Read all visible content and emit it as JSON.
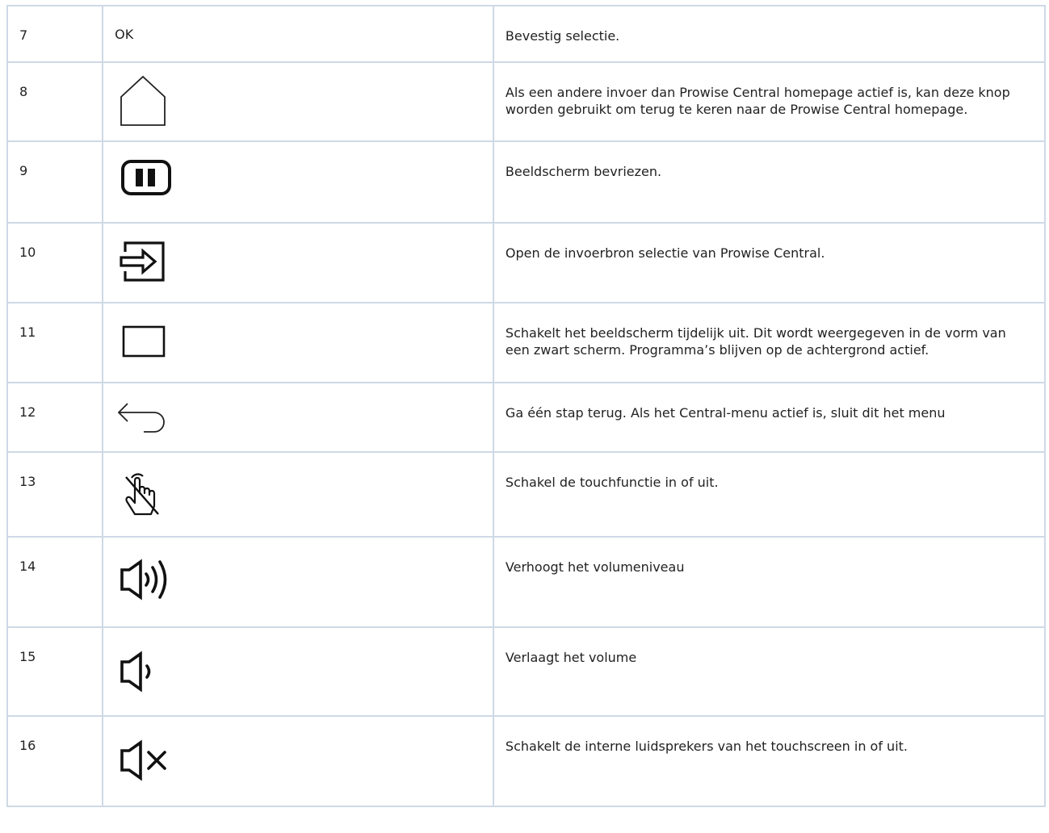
{
  "rows": [
    {
      "number": "7",
      "icon": "ok-text",
      "icon_text": "OK",
      "description": "Bevestig selectie."
    },
    {
      "number": "8",
      "icon": "home-icon",
      "description": "Als een andere invoer dan Prowise Central homepage actief is, kan deze knop worden gebruikt om terug te keren naar de Prowise Central homepage."
    },
    {
      "number": "9",
      "icon": "pause-icon",
      "description": "Beeldscherm bevriezen."
    },
    {
      "number": "10",
      "icon": "input-source-icon",
      "description": "Open de invoerbron selectie van Prowise Central."
    },
    {
      "number": "11",
      "icon": "blank-screen-icon",
      "description": "Schakelt het beeldscherm tijdelijk uit. Dit wordt weergegeven in de vorm van een zwart scherm. Programma’s blijven op de achtergrond actief."
    },
    {
      "number": "12",
      "icon": "back-arrow-icon",
      "description": "Ga één stap terug. Als het Central-menu actief is, sluit dit het menu"
    },
    {
      "number": "13",
      "icon": "touch-off-icon",
      "description": "Schakel de touchfunctie in of uit."
    },
    {
      "number": "14",
      "icon": "volume-up-icon",
      "description": "Verhoogt het volumeniveau"
    },
    {
      "number": "15",
      "icon": "volume-down-icon",
      "description": "Verlaagt het volume"
    },
    {
      "number": "16",
      "icon": "mute-icon",
      "description": "Schakelt de interne luidsprekers van het touchscreen in of uit."
    }
  ]
}
